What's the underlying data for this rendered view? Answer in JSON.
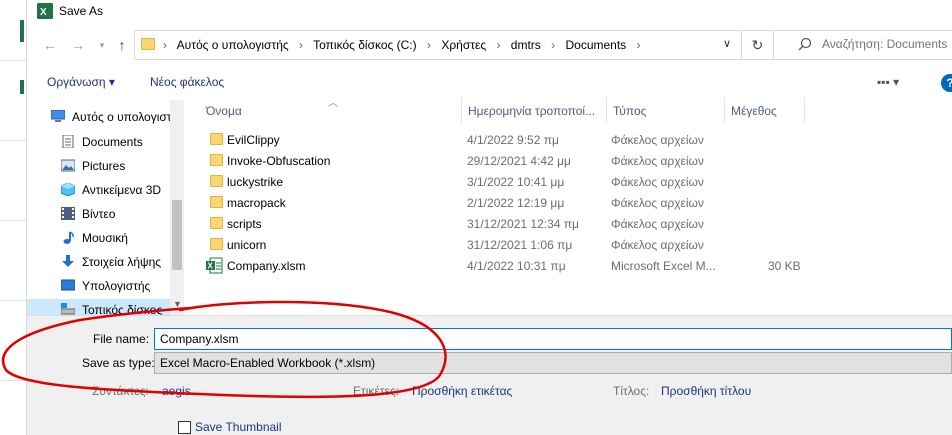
{
  "window": {
    "title": "Save As"
  },
  "nav": {
    "breadcrumbs": [
      "Αυτός ο υπολογιστής",
      "Τοπικός δίσκος (C:)",
      "Χρήστες",
      "dmtrs",
      "Documents"
    ],
    "search_placeholder": "Αναζήτηση: Documents"
  },
  "toolbar": {
    "organize_label": "Οργάνωση ▾",
    "new_folder_label": "Νέος φάκελος",
    "view_label": "▪▪▪ ▾",
    "help_label": "?"
  },
  "sidebar": {
    "items": [
      {
        "label": "Αυτός ο υπολογιστής",
        "icon": "computer-icon"
      },
      {
        "label": "Documents",
        "icon": "documents-icon"
      },
      {
        "label": "Pictures",
        "icon": "pictures-icon"
      },
      {
        "label": "Αντικείμενα 3D",
        "icon": "objects-3d-icon"
      },
      {
        "label": "Βίντεο",
        "icon": "video-icon"
      },
      {
        "label": "Μουσική",
        "icon": "music-icon"
      },
      {
        "label": "Στοιχεία λήψης",
        "icon": "downloads-icon"
      },
      {
        "label": "Υπολογιστής",
        "icon": "desktop-icon"
      },
      {
        "label": "Τοπικός δίσκος",
        "icon": "drive-icon"
      }
    ]
  },
  "columns": {
    "name": "Όνομα",
    "date": "Ημερομηνία τροποποί...",
    "type": "Τύπος",
    "size": "Μέγεθος"
  },
  "files": [
    {
      "name": "EvilClippy",
      "date": "4/1/2022 9:52 πμ",
      "type": "Φάκελος αρχείων",
      "size": "",
      "kind": "folder"
    },
    {
      "name": "Invoke-Obfuscation",
      "date": "29/12/2021 4:42 μμ",
      "type": "Φάκελος αρχείων",
      "size": "",
      "kind": "folder"
    },
    {
      "name": "luckystrike",
      "date": "3/1/2022 10:41 μμ",
      "type": "Φάκελος αρχείων",
      "size": "",
      "kind": "folder"
    },
    {
      "name": "macropack",
      "date": "2/1/2022 12:19 μμ",
      "type": "Φάκελος αρχείων",
      "size": "",
      "kind": "folder"
    },
    {
      "name": "scripts",
      "date": "31/12/2021 12:34 πμ",
      "type": "Φάκελος αρχείων",
      "size": "",
      "kind": "folder"
    },
    {
      "name": "unicorn",
      "date": "31/12/2021 1:06 πμ",
      "type": "Φάκελος αρχείων",
      "size": "",
      "kind": "folder"
    },
    {
      "name": "Company.xlsm",
      "date": "4/1/2022 10:31 πμ",
      "type": "Microsoft Excel M...",
      "size": "30 KB",
      "kind": "excel"
    }
  ],
  "form": {
    "file_name_label": "File name:",
    "file_name_value": "Company.xlsm",
    "save_type_label": "Save as type:",
    "save_type_value": "Excel Macro-Enabled Workbook (*.xlsm)",
    "authors_label": "Συντάκτες:",
    "authors_value": "aegis",
    "tags_label": "Ετικέτες:",
    "tags_value": "Προσθήκη ετικέτας",
    "title_label": "Τίτλος:",
    "title_value": "Προσθήκη τίτλου",
    "thumbnail_label": "Save Thumbnail"
  },
  "colors": {
    "accent": "#0078d7",
    "link": "#1e3287",
    "excel_green": "#217346",
    "annotation_red": "#e00000"
  }
}
